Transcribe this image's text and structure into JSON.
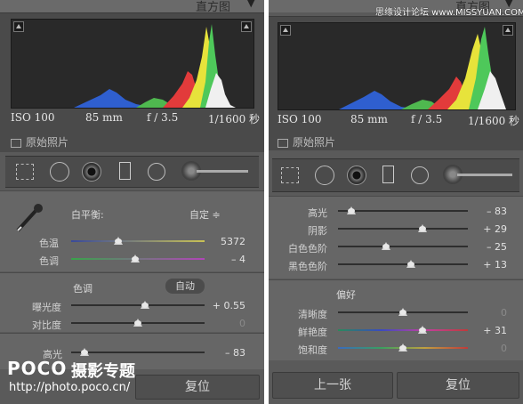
{
  "left": {
    "header": {
      "title": "直方图",
      "arrow": "▼"
    },
    "histogram": {
      "iso": "ISO 100",
      "focal": "85 mm",
      "aperture": "f / 3.5",
      "shutter": "1/1600 秒",
      "original_photo": "原始照片"
    },
    "tools": [
      "crop-overlay",
      "spot-removal",
      "red-eye",
      "graduated-filter",
      "radial-filter",
      "adjustment-brush"
    ],
    "basic": {
      "wb_label": "白平衡:",
      "wb_value": "自定 ≑",
      "sliders": [
        {
          "label": "色温",
          "value": "5372"
        },
        {
          "label": "色调",
          "value": "– 4"
        }
      ],
      "tone_header": "色调",
      "auto_label": "自动",
      "tone_sliders": [
        {
          "label": "曝光度",
          "value": "+ 0.55"
        },
        {
          "label": "对比度",
          "value": "0"
        }
      ],
      "highlights": {
        "label": "高光",
        "value": "– 83"
      }
    },
    "buttons": {
      "reset": "复位"
    },
    "watermark": {
      "brand": "POCO",
      "title": "摄影专题",
      "url": "http://photo.poco.cn/"
    }
  },
  "right": {
    "header": {
      "title": "直方图",
      "arrow": "▼",
      "site": "思缘设计论坛 www.MISSYUAN.COM"
    },
    "histogram": {
      "iso": "ISO 100",
      "focal": "85 mm",
      "aperture": "f / 3.5",
      "shutter": "1/1600 秒",
      "original_photo": "原始照片"
    },
    "sliders": [
      {
        "label": "高光",
        "value": "– 83"
      },
      {
        "label": "阴影",
        "value": "+ 29"
      },
      {
        "label": "白色色阶",
        "value": "– 25"
      },
      {
        "label": "黑色色阶",
        "value": "+ 13"
      }
    ],
    "presence_header": "偏好",
    "presence_sliders": [
      {
        "label": "清晰度",
        "value": "0"
      },
      {
        "label": "鲜艳度",
        "value": "+ 31"
      },
      {
        "label": "饱和度",
        "value": "0"
      }
    ],
    "buttons": {
      "prev": "上一张",
      "reset": "复位"
    }
  },
  "slider_levels": {
    "left_temp": 0.35,
    "left_tint": 0.48,
    "left_exposure": 0.55,
    "left_contrast": 0.5,
    "left_highlights": 0.1,
    "right_highlights": 0.1,
    "right_shadows": 0.65,
    "right_whites": 0.37,
    "right_blacks": 0.56,
    "right_clarity": 0.5,
    "right_vibrance": 0.65,
    "right_saturation": 0.5
  },
  "colors": {
    "panel": "#5a5a5a",
    "section": "#666666",
    "histogram_bg": "#292929",
    "text": "#d2d2d2"
  }
}
